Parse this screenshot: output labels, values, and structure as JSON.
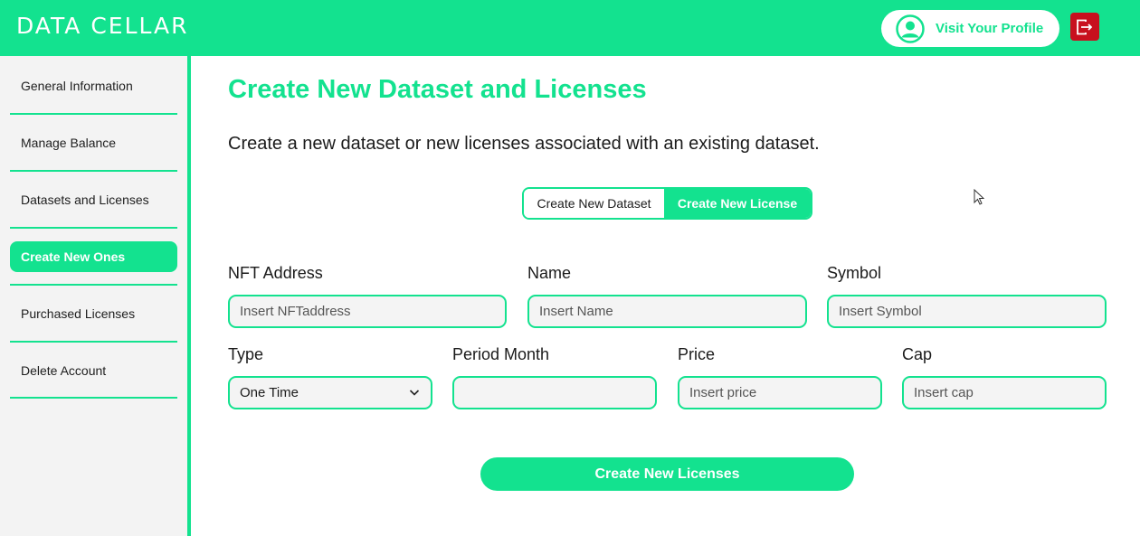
{
  "header": {
    "logo_text": "DATA CELLAR",
    "profile_label": "Visit Your Profile",
    "profile_icon": "user-circle-icon",
    "logout_icon": "logout-icon",
    "brand_color": "#13e28f",
    "logout_color": "#c8101e"
  },
  "sidebar": {
    "items": [
      {
        "label": "General Information",
        "active": false
      },
      {
        "label": "Manage Balance",
        "active": false
      },
      {
        "label": "Datasets and Licenses",
        "active": false
      },
      {
        "label": "Create New Ones",
        "active": true
      },
      {
        "label": "Purchased Licenses",
        "active": false
      },
      {
        "label": "Delete Account",
        "active": false
      }
    ]
  },
  "main": {
    "title": "Create New Dataset and Licenses",
    "subtitle": "Create a new dataset or new licenses associated with an existing dataset.",
    "toggle": {
      "dataset_label": "Create New Dataset",
      "license_label": "Create New License",
      "selected": "Create New License"
    },
    "form": {
      "nft_address": {
        "label": "NFT Address",
        "placeholder": "Insert NFTaddress",
        "value": ""
      },
      "name": {
        "label": "Name",
        "placeholder": "Insert Name",
        "value": ""
      },
      "symbol": {
        "label": "Symbol",
        "placeholder": "Insert Symbol",
        "value": ""
      },
      "type": {
        "label": "Type",
        "value": "One Time"
      },
      "period_month": {
        "label": "Period Month",
        "placeholder": "",
        "value": ""
      },
      "price": {
        "label": "Price",
        "placeholder": "Insert price",
        "value": ""
      },
      "cap": {
        "label": "Cap",
        "placeholder": "Insert cap",
        "value": ""
      }
    },
    "submit_label": "Create New Licenses"
  }
}
